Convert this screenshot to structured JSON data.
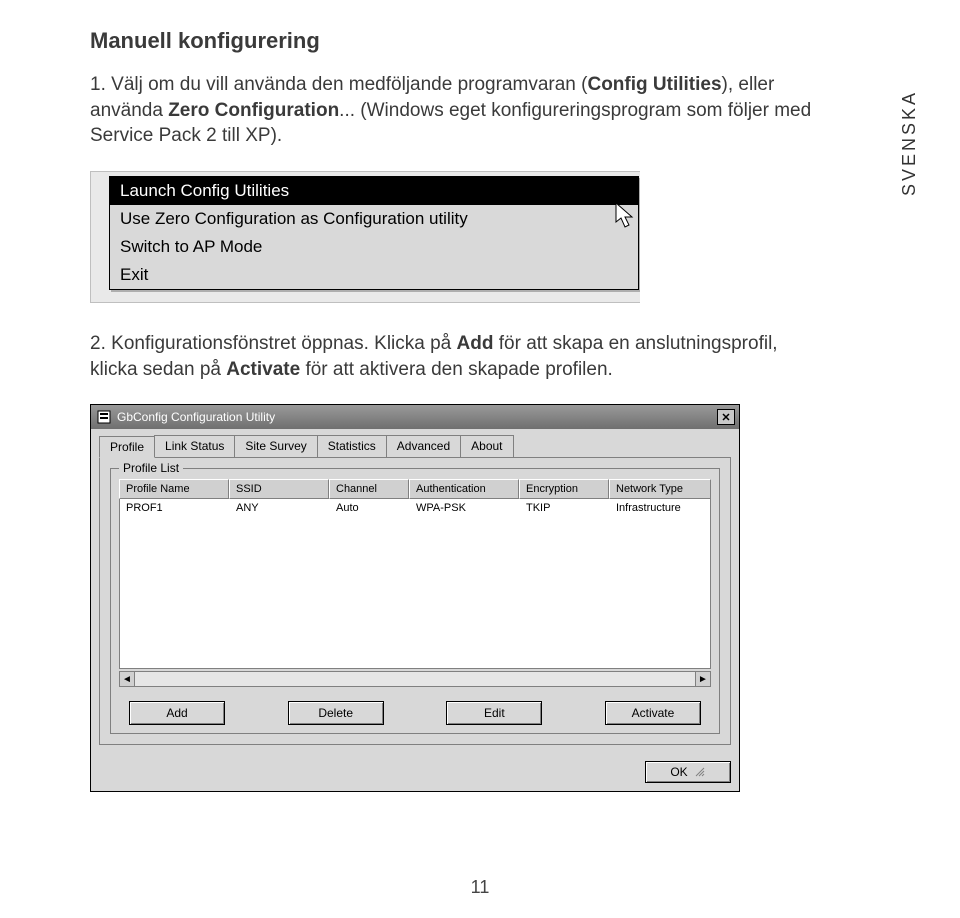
{
  "side_label": "SVENSKA",
  "title": "Manuell konfigurering",
  "paragraph1": {
    "num": "1.",
    "t1": "Välj om du vill använda den medföljande programvaran (",
    "bold1": "Config Utilities",
    "t2": "), eller använda ",
    "bold2": "Zero Configuration",
    "t3": "... (Windows eget konfigureringsprogram som följer med Service Pack 2 till XP)."
  },
  "context_menu": {
    "items": [
      "Launch Config Utilities",
      "Use Zero Configuration as Configuration utility",
      "Switch to AP Mode",
      "Exit"
    ],
    "selected_index": 0
  },
  "paragraph2": {
    "num": "2.",
    "t1": "Konfigurationsfönstret öppnas. Klicka på ",
    "bold1": "Add",
    "t2": " för att skapa en anslutnings­profil, klicka sedan på ",
    "bold2": "Activate",
    "t3": " för att aktivera den skapade profilen."
  },
  "window": {
    "title": "GbConfig Configuration Utility",
    "tabs": [
      "Profile",
      "Link Status",
      "Site Survey",
      "Statistics",
      "Advanced",
      "About"
    ],
    "active_tab_index": 0,
    "group_label": "Profile List",
    "columns": [
      "Profile Name",
      "SSID",
      "Channel",
      "Authentication",
      "Encryption",
      "Network Type"
    ],
    "rows": [
      {
        "profile_name": "PROF1",
        "ssid": "ANY",
        "channel": "Auto",
        "auth": "WPA-PSK",
        "enc": "TKIP",
        "ntype": "Infrastructure"
      }
    ],
    "buttons": {
      "add": "Add",
      "delete": "Delete",
      "edit": "Edit",
      "activate": "Activate"
    },
    "ok": "OK"
  },
  "page_number": "11"
}
